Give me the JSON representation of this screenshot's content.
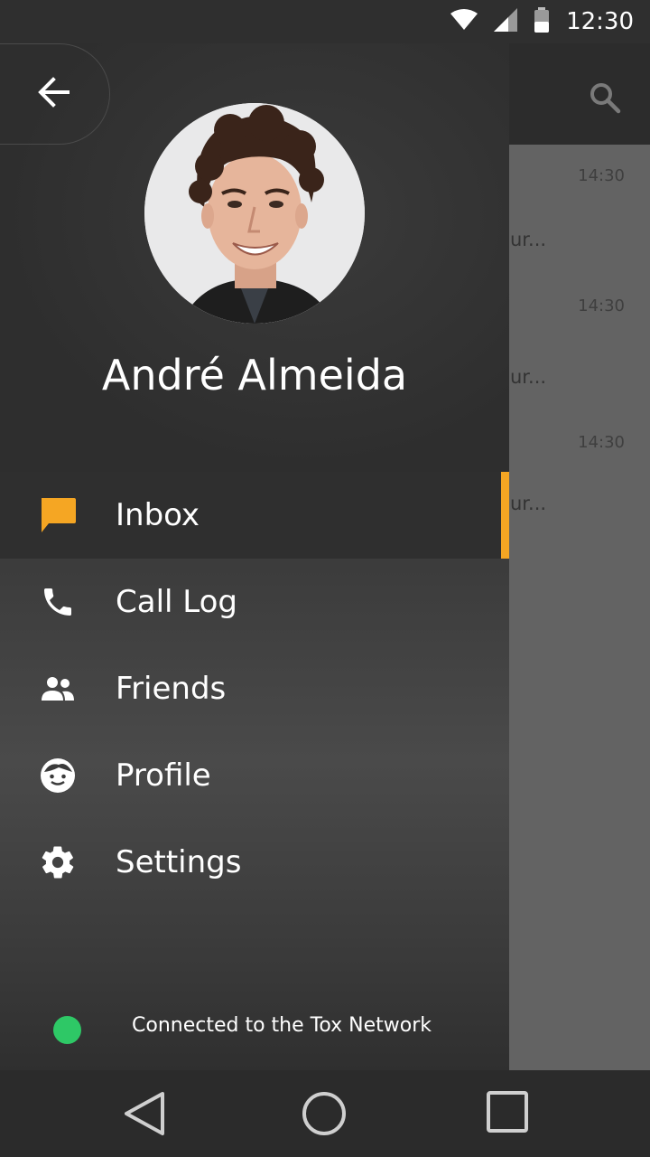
{
  "status_bar": {
    "time": "12:30",
    "icons": [
      "wifi-icon",
      "signal-icon",
      "battery-icon"
    ]
  },
  "background_app": {
    "toolbar_icon": "search-icon",
    "rows": [
      {
        "time": "14:30",
        "snippet": "ur..."
      },
      {
        "time": "14:30",
        "snippet": "ur..."
      },
      {
        "time": "14:30",
        "snippet": "ur..."
      }
    ]
  },
  "drawer": {
    "back_icon": "arrow-back-icon",
    "profile_name": "André Almeida",
    "items": [
      {
        "label": "Inbox",
        "icon": "chat-bubble-icon",
        "active": true
      },
      {
        "label": "Call Log",
        "icon": "phone-icon",
        "active": false
      },
      {
        "label": "Friends",
        "icon": "people-icon",
        "active": false
      },
      {
        "label": "Profile",
        "icon": "face-icon",
        "active": false
      },
      {
        "label": "Settings",
        "icon": "gear-icon",
        "active": false
      }
    ],
    "connection_status": "Connected to the Tox Network"
  },
  "colors": {
    "accent": "#f5a623",
    "online": "#2ec866",
    "drawer_bg": "#2c2c2c"
  },
  "nav_bar": {
    "buttons": [
      "back-triangle-icon",
      "home-circle-icon",
      "recents-square-icon"
    ]
  }
}
